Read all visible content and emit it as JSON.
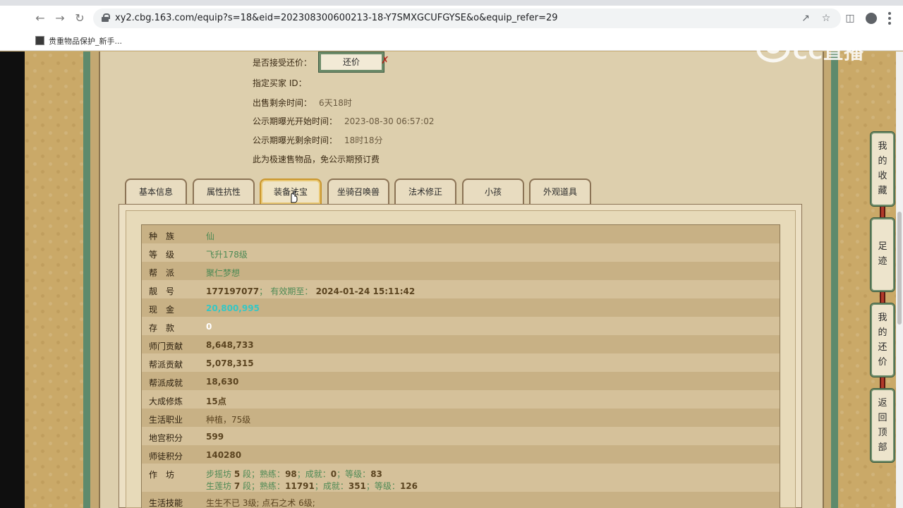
{
  "browser": {
    "url": "xy2.cbg.163.com/equip?s=18&eid=202308300600213-18-Y7SMXGCUFGYSE&o&equip_refer=29",
    "bookmark_label": "贵重物品保护_新手...",
    "watermark": "CC直播"
  },
  "listing": {
    "accept_counter_label": "是否接受还价：",
    "counter_button": "还价",
    "buyer_id_label": "指定买家 ID：",
    "remaining_label": "出售剩余时间：",
    "remaining_value": "6天18时",
    "exposure_start_label": "公示期曝光开始时间：",
    "exposure_start_value": "2023-08-30 06:57:02",
    "exposure_left_label": "公示期曝光剩余时间：",
    "exposure_left_value": "18时18分",
    "fast_sale_note": "此为极速售物品，免公示期预订费"
  },
  "tabs": [
    "基本信息",
    "属性抗性",
    "装备法宝",
    "坐骑召唤兽",
    "法术修正",
    "小孩",
    "外观道具"
  ],
  "active_tab": "装备法宝",
  "rows": {
    "race": {
      "label": "种　族",
      "value": "仙"
    },
    "level": {
      "label": "等　级",
      "value": "飞升178级"
    },
    "guild": {
      "label": "帮　派",
      "value": "聚仁梦想"
    },
    "id": {
      "label": "靓　号",
      "value": "177197077",
      "sep": "；",
      "valid_label": "有效期至：",
      "valid_value": "2024-01-24 15:11:42"
    },
    "cash": {
      "label": "现　金",
      "value": "20,800,995"
    },
    "deposit": {
      "label": "存　款",
      "value": "0"
    },
    "school_contrib": {
      "label": "师门贡献",
      "value": "8,648,733"
    },
    "guild_contrib": {
      "label": "帮派贡献",
      "value": "5,078,315"
    },
    "guild_achieve": {
      "label": "帮派成就",
      "value": "18,630"
    },
    "cultivation": {
      "label": "大成修炼",
      "value": "15点"
    },
    "life_job": {
      "label": "生活职业",
      "value": "种植，75级"
    },
    "palace_points": {
      "label": "地宫积分",
      "value": "599"
    },
    "mentor_points": {
      "label": "师徒积分",
      "value": "140280"
    },
    "workshop": {
      "label": "作　坊",
      "line1": {
        "name": "步摇坊",
        "stage": "5",
        "stage_unit": "段；",
        "skill_label": "熟练：",
        "skill": "98",
        "sep1": "；",
        "achieve_label": "成就：",
        "achieve": "0",
        "sep2": "；",
        "grade_label": "等级：",
        "grade": "83"
      },
      "line2": {
        "name": "生莲坊",
        "stage": "7",
        "stage_unit": "段；",
        "skill_label": "熟练：",
        "skill": "11791",
        "sep1": "；",
        "achieve_label": "成就：",
        "achieve": "351",
        "sep2": "；",
        "grade_label": "等级：",
        "grade": "126"
      }
    },
    "life_skill": {
      "label": "生活技能",
      "value": "生生不已 3级; 点石之术 6级;"
    }
  },
  "sidebar": [
    "我的收藏",
    "足迹",
    "我的还价",
    "返回顶部"
  ],
  "colors": {
    "green_text": "#4e8a55",
    "cash_cyan": "#35c7c5",
    "frame_green": "#5e8a6c"
  }
}
